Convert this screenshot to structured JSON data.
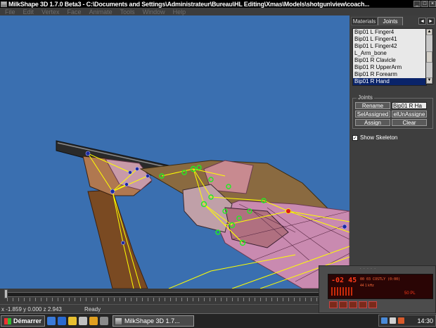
{
  "window": {
    "title": "MilkShape 3D 1.7.0 Beta3 - C:\\Documents and Settings\\Administrateur\\Bureau\\HL Editing\\Xmas\\Models\\shotgun\\view\\coach...",
    "buttons": [
      "_",
      "□",
      "×"
    ]
  },
  "menu": [
    "File",
    "Edit",
    "Vertex",
    "Face",
    "Animate",
    "Tools",
    "Window",
    "Help"
  ],
  "panel": {
    "tabs": [
      "Materials",
      "Joints"
    ],
    "active_tab": "Joints",
    "nav": [
      "◄",
      "►"
    ],
    "joint_list": [
      "Bip01 L Finger4",
      "Bip01 L Finger41",
      "Bip01 L Finger42",
      "L_Arm_bone",
      "Bip01 R Clavicle",
      "Bip01 R UpperArm",
      "Bip01 R Forearm",
      "Bip01 R Hand"
    ],
    "selected_joint": "Bip01 R Hand",
    "joints_group": {
      "title": "Joints",
      "rename_label": "Rename",
      "name_value": "Bip01 R Ha",
      "sel_assigned_label": "SelAssigned",
      "sel_unassigned_label": "elUnAssigne",
      "assign_label": "Assign",
      "clear_label": "Clear"
    },
    "show_skeleton": {
      "label": "Show Skeleton",
      "checked": true
    }
  },
  "status": {
    "coords": "x -1.859 y 0.000 z 2.943",
    "text": "Ready"
  },
  "player_widget": {
    "time": "-02 45",
    "track": "00 03 COSTLY (0:00)",
    "meta": "44 1 kHz",
    "volume": "50 PL"
  },
  "taskbar": {
    "start_label": "Démarrer",
    "task_label": "MilkShape 3D 1.7...",
    "clock": "14:30"
  },
  "colors": {
    "viewport_bg": "#3a6fb0",
    "skeleton": "#ffff00",
    "joint_green": "#22ee22",
    "joint_blue": "#1a2aa0",
    "mesh_pink": "#c98ab0"
  }
}
